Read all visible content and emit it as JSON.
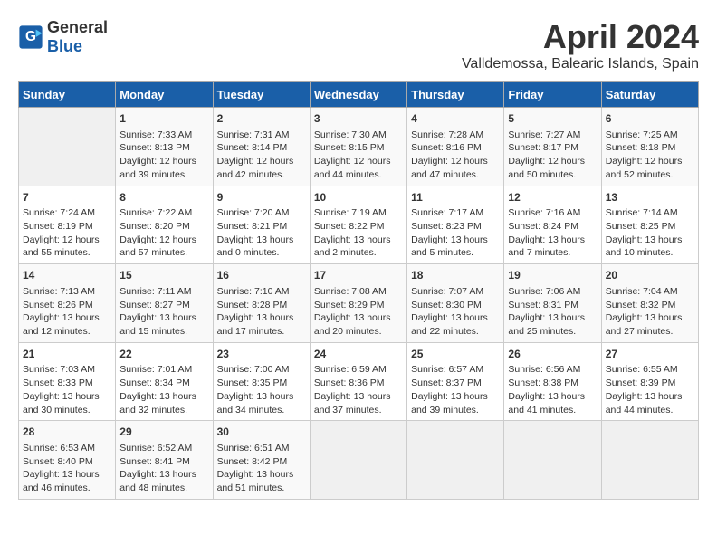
{
  "logo": {
    "general": "General",
    "blue": "Blue"
  },
  "title": "April 2024",
  "subtitle": "Valldemossa, Balearic Islands, Spain",
  "days_of_week": [
    "Sunday",
    "Monday",
    "Tuesday",
    "Wednesday",
    "Thursday",
    "Friday",
    "Saturday"
  ],
  "weeks": [
    [
      {
        "day": "",
        "info": ""
      },
      {
        "day": "1",
        "info": "Sunrise: 7:33 AM\nSunset: 8:13 PM\nDaylight: 12 hours\nand 39 minutes."
      },
      {
        "day": "2",
        "info": "Sunrise: 7:31 AM\nSunset: 8:14 PM\nDaylight: 12 hours\nand 42 minutes."
      },
      {
        "day": "3",
        "info": "Sunrise: 7:30 AM\nSunset: 8:15 PM\nDaylight: 12 hours\nand 44 minutes."
      },
      {
        "day": "4",
        "info": "Sunrise: 7:28 AM\nSunset: 8:16 PM\nDaylight: 12 hours\nand 47 minutes."
      },
      {
        "day": "5",
        "info": "Sunrise: 7:27 AM\nSunset: 8:17 PM\nDaylight: 12 hours\nand 50 minutes."
      },
      {
        "day": "6",
        "info": "Sunrise: 7:25 AM\nSunset: 8:18 PM\nDaylight: 12 hours\nand 52 minutes."
      }
    ],
    [
      {
        "day": "7",
        "info": "Sunrise: 7:24 AM\nSunset: 8:19 PM\nDaylight: 12 hours\nand 55 minutes."
      },
      {
        "day": "8",
        "info": "Sunrise: 7:22 AM\nSunset: 8:20 PM\nDaylight: 12 hours\nand 57 minutes."
      },
      {
        "day": "9",
        "info": "Sunrise: 7:20 AM\nSunset: 8:21 PM\nDaylight: 13 hours\nand 0 minutes."
      },
      {
        "day": "10",
        "info": "Sunrise: 7:19 AM\nSunset: 8:22 PM\nDaylight: 13 hours\nand 2 minutes."
      },
      {
        "day": "11",
        "info": "Sunrise: 7:17 AM\nSunset: 8:23 PM\nDaylight: 13 hours\nand 5 minutes."
      },
      {
        "day": "12",
        "info": "Sunrise: 7:16 AM\nSunset: 8:24 PM\nDaylight: 13 hours\nand 7 minutes."
      },
      {
        "day": "13",
        "info": "Sunrise: 7:14 AM\nSunset: 8:25 PM\nDaylight: 13 hours\nand 10 minutes."
      }
    ],
    [
      {
        "day": "14",
        "info": "Sunrise: 7:13 AM\nSunset: 8:26 PM\nDaylight: 13 hours\nand 12 minutes."
      },
      {
        "day": "15",
        "info": "Sunrise: 7:11 AM\nSunset: 8:27 PM\nDaylight: 13 hours\nand 15 minutes."
      },
      {
        "day": "16",
        "info": "Sunrise: 7:10 AM\nSunset: 8:28 PM\nDaylight: 13 hours\nand 17 minutes."
      },
      {
        "day": "17",
        "info": "Sunrise: 7:08 AM\nSunset: 8:29 PM\nDaylight: 13 hours\nand 20 minutes."
      },
      {
        "day": "18",
        "info": "Sunrise: 7:07 AM\nSunset: 8:30 PM\nDaylight: 13 hours\nand 22 minutes."
      },
      {
        "day": "19",
        "info": "Sunrise: 7:06 AM\nSunset: 8:31 PM\nDaylight: 13 hours\nand 25 minutes."
      },
      {
        "day": "20",
        "info": "Sunrise: 7:04 AM\nSunset: 8:32 PM\nDaylight: 13 hours\nand 27 minutes."
      }
    ],
    [
      {
        "day": "21",
        "info": "Sunrise: 7:03 AM\nSunset: 8:33 PM\nDaylight: 13 hours\nand 30 minutes."
      },
      {
        "day": "22",
        "info": "Sunrise: 7:01 AM\nSunset: 8:34 PM\nDaylight: 13 hours\nand 32 minutes."
      },
      {
        "day": "23",
        "info": "Sunrise: 7:00 AM\nSunset: 8:35 PM\nDaylight: 13 hours\nand 34 minutes."
      },
      {
        "day": "24",
        "info": "Sunrise: 6:59 AM\nSunset: 8:36 PM\nDaylight: 13 hours\nand 37 minutes."
      },
      {
        "day": "25",
        "info": "Sunrise: 6:57 AM\nSunset: 8:37 PM\nDaylight: 13 hours\nand 39 minutes."
      },
      {
        "day": "26",
        "info": "Sunrise: 6:56 AM\nSunset: 8:38 PM\nDaylight: 13 hours\nand 41 minutes."
      },
      {
        "day": "27",
        "info": "Sunrise: 6:55 AM\nSunset: 8:39 PM\nDaylight: 13 hours\nand 44 minutes."
      }
    ],
    [
      {
        "day": "28",
        "info": "Sunrise: 6:53 AM\nSunset: 8:40 PM\nDaylight: 13 hours\nand 46 minutes."
      },
      {
        "day": "29",
        "info": "Sunrise: 6:52 AM\nSunset: 8:41 PM\nDaylight: 13 hours\nand 48 minutes."
      },
      {
        "day": "30",
        "info": "Sunrise: 6:51 AM\nSunset: 8:42 PM\nDaylight: 13 hours\nand 51 minutes."
      },
      {
        "day": "",
        "info": ""
      },
      {
        "day": "",
        "info": ""
      },
      {
        "day": "",
        "info": ""
      },
      {
        "day": "",
        "info": ""
      }
    ]
  ]
}
